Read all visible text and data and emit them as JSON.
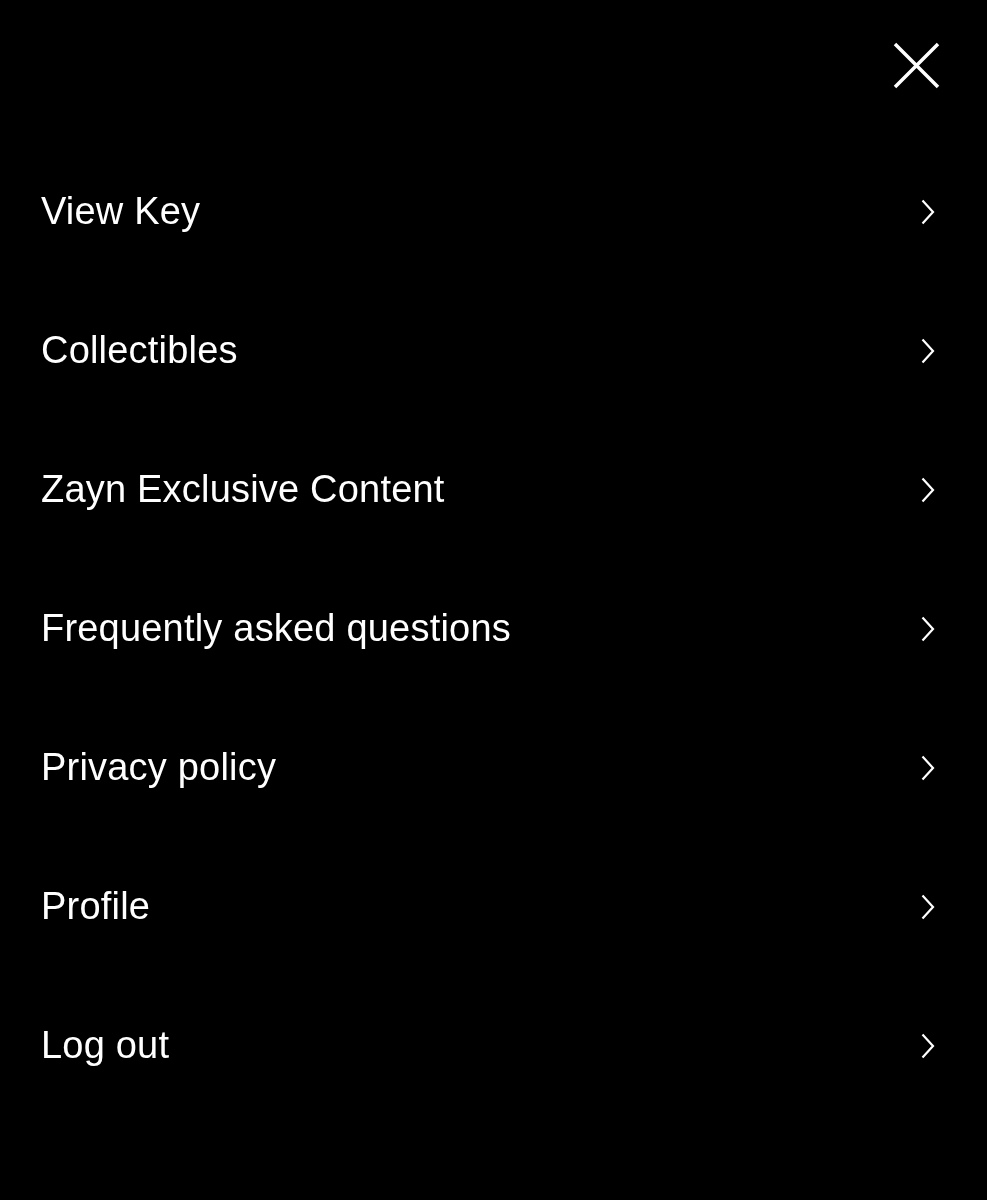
{
  "menu": {
    "items": [
      {
        "label": "View Key"
      },
      {
        "label": "Collectibles"
      },
      {
        "label": "Zayn Exclusive Content"
      },
      {
        "label": "Frequently asked questions"
      },
      {
        "label": "Privacy policy"
      },
      {
        "label": "Profile"
      },
      {
        "label": "Log out"
      }
    ]
  }
}
